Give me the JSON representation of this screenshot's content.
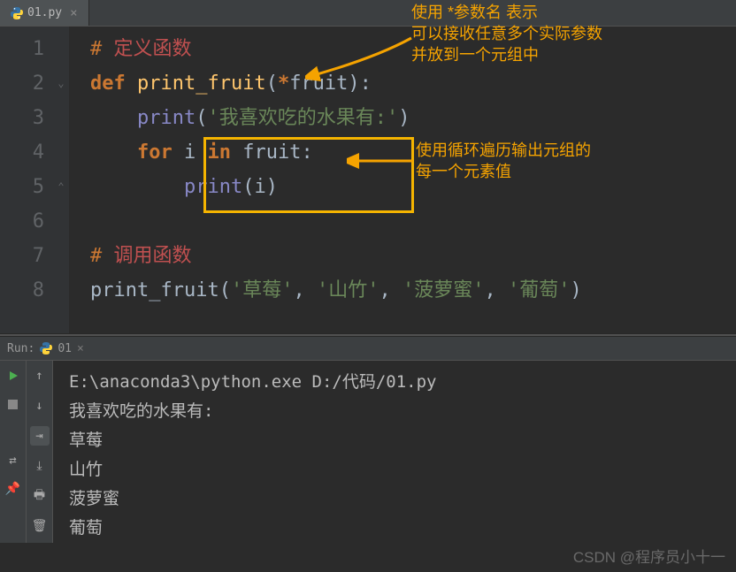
{
  "tab": {
    "filename": "01.py"
  },
  "gutter": [
    "1",
    "2",
    "3",
    "4",
    "5",
    "6",
    "7",
    "8"
  ],
  "code": {
    "l1": {
      "hash": "# ",
      "text": "定义函数"
    },
    "l2": {
      "def": "def ",
      "fn": "print_fruit",
      "open": "(",
      "star": "*",
      "arg": "fruit",
      "close": "):"
    },
    "l3": {
      "indent": "    ",
      "print": "print",
      "open": "(",
      "str": "'我喜欢吃的水果有:'",
      "close": ")"
    },
    "l4": {
      "indent": "    ",
      "for": "for ",
      "i": "i",
      "in": " in ",
      "it": "fruit",
      "colon": ":"
    },
    "l5": {
      "indent": "        ",
      "print": "print",
      "open": "(",
      "arg": "i",
      "close": ")"
    },
    "l7": {
      "hash": "# ",
      "text": "调用函数"
    },
    "l8": {
      "fn": "print_fruit",
      "open": "(",
      "a1": "'草莓'",
      "c": ", ",
      "a2": "'山竹'",
      "a3": "'菠萝蜜'",
      "a4": "'葡萄'",
      "close": ")"
    }
  },
  "annotation1": {
    "l1": "使用 *参数名 表示",
    "l2": "可以接收任意多个实际参数",
    "l3": "并放到一个元组中"
  },
  "annotation2": {
    "l1": "使用循环遍历输出元组的",
    "l2": "每一个元素值"
  },
  "run": {
    "label": "Run:",
    "config": "01",
    "lines": [
      "E:\\anaconda3\\python.exe D:/代码/01.py",
      "我喜欢吃的水果有:",
      "草莓",
      "山竹",
      "菠萝蜜",
      "葡萄"
    ]
  },
  "watermark": "CSDN @程序员小十一"
}
